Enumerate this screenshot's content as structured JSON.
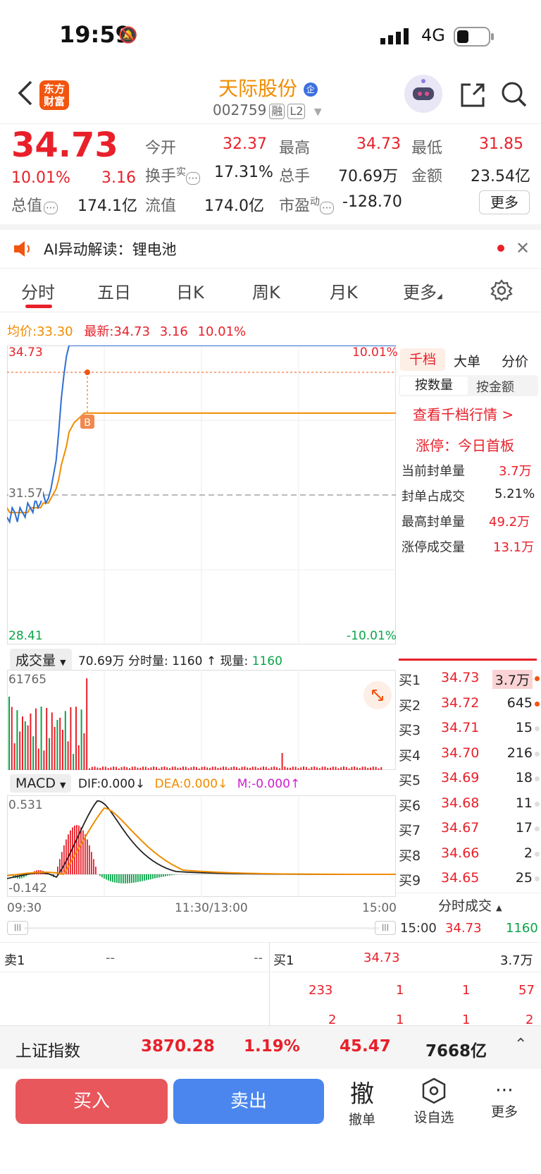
{
  "status_bar": {
    "time": "19:59",
    "network": "4G"
  },
  "header": {
    "title": "天际股份",
    "code": "002759",
    "tag_margin": "融",
    "tag_level": "L2",
    "logo_line1": "东方",
    "logo_line2": "财富"
  },
  "quote": {
    "price": "34.73",
    "pct": "10.01%",
    "change": "3.16",
    "stats": [
      {
        "label": "今开",
        "value": "32.37"
      },
      {
        "label": "最高",
        "value": "34.73"
      },
      {
        "label": "最低",
        "value": "31.85"
      },
      {
        "label": "换手",
        "sup": "实",
        "value": "17.31%"
      },
      {
        "label": "总手",
        "value": "70.69万"
      },
      {
        "label": "金额",
        "value": "23.54亿"
      },
      {
        "label": "总值",
        "value": "174.1亿"
      },
      {
        "label": "流值",
        "value": "174.0亿"
      },
      {
        "label": "市盈",
        "sup": "动",
        "value": "-128.70"
      }
    ],
    "more_label": "更多"
  },
  "ai_bar": {
    "label": "AI异动解读：",
    "value": "锂电池"
  },
  "tabs": [
    "分时",
    "五日",
    "日K",
    "周K",
    "月K",
    "更多"
  ],
  "chart_info": {
    "avg_label": "均价:",
    "avg_value": "33.30",
    "latest_label": "最新:",
    "latest_value": "34.73",
    "change": "3.16",
    "pct": "10.01%"
  },
  "chart_data": {
    "type": "line",
    "y_high": "34.73",
    "y_high_pct": "10.01%",
    "y_ref": "31.57",
    "y_low": "28.41",
    "y_low_pct": "-10.01%",
    "ylim": [
      28.41,
      34.73
    ],
    "x_labels": [
      "09:30",
      "11:30/13:00",
      "15:00"
    ],
    "marker": "B",
    "series": [
      {
        "values": [
          31.1,
          31.0,
          31.3,
          31.2,
          31.0,
          31.3,
          31.2,
          31.1,
          31.4,
          31.3,
          31.2,
          31.5,
          31.3,
          31.4,
          31.6,
          31.4,
          31.5,
          31.7,
          32.0,
          32.3,
          32.9,
          33.6,
          34.1,
          34.5,
          34.73,
          34.73,
          34.73,
          34.73,
          34.73,
          34.73,
          34.73
        ]
      },
      {
        "values": [
          31.3,
          31.2,
          31.2,
          31.2,
          31.2,
          31.2,
          31.2,
          31.2,
          31.2,
          31.3,
          31.3,
          31.3,
          31.3,
          31.3,
          31.4,
          31.4,
          31.4,
          31.5,
          31.6,
          31.7,
          31.9,
          32.2,
          32.4,
          32.6,
          32.9,
          33.0,
          33.1,
          33.15,
          33.2,
          33.25,
          33.3
        ]
      }
    ]
  },
  "volume": {
    "selector": "成交量",
    "total": "70.69万",
    "tick_label": "分时量:",
    "tick_value": "1160",
    "arrow": "↑",
    "now_label": "现量:",
    "now_value": "1160",
    "max": "61765"
  },
  "macd": {
    "selector": "MACD",
    "dif": "DIF:0.000",
    "dif_arrow": "↓",
    "dea": "DEA:0.000",
    "dea_arrow": "↓",
    "m": "M:-0.000",
    "m_arrow": "↑",
    "max": "0.531",
    "min": "-0.142"
  },
  "right_panel": {
    "tabs": [
      "千档",
      "大单",
      "分价"
    ],
    "sub_tabs": [
      "按数量",
      "按金额"
    ],
    "link": "查看千档行情 >",
    "limit_label": "涨停：",
    "limit_value": "今日首板",
    "rows": [
      {
        "label": "当前封单量",
        "value": "3.7万"
      },
      {
        "label": "封单占成交",
        "value": "5.21%"
      },
      {
        "label": "最高封单量",
        "value": "49.2万"
      },
      {
        "label": "涨停成交量",
        "value": "13.1万"
      }
    ],
    "bids": [
      {
        "label": "买1",
        "price": "34.73",
        "vol": "3.7万"
      },
      {
        "label": "买2",
        "price": "34.72",
        "vol": "645"
      },
      {
        "label": "买3",
        "price": "34.71",
        "vol": "15"
      },
      {
        "label": "买4",
        "price": "34.70",
        "vol": "216"
      },
      {
        "label": "买5",
        "price": "34.69",
        "vol": "18"
      },
      {
        "label": "买6",
        "price": "34.68",
        "vol": "11"
      },
      {
        "label": "买7",
        "price": "34.67",
        "vol": "17"
      },
      {
        "label": "买8",
        "price": "34.66",
        "vol": "2"
      },
      {
        "label": "买9",
        "price": "34.65",
        "vol": "25"
      }
    ],
    "ticks_title": "分时成交",
    "last_tick": {
      "time": "15:00",
      "price": "34.73",
      "vol": "1160"
    }
  },
  "order_book": {
    "sell_label": "卖1",
    "sell_price": "--",
    "sell_vol": "--",
    "buy_label": "买1",
    "buy_price": "34.73",
    "buy_vol": "3.7万",
    "rows": [
      [
        "233",
        "1",
        "1",
        "57"
      ],
      [
        "2",
        "1",
        "1",
        "2"
      ]
    ]
  },
  "index_bar": {
    "name": "上证指数",
    "value": "3870.28",
    "pct": "1.19%",
    "change": "45.47",
    "amount": "7668亿"
  },
  "bottom": {
    "buy": "买入",
    "sell": "卖出",
    "cancel_big": "撤",
    "cancel": "撤单",
    "watch": "设自选",
    "more": "更多"
  }
}
